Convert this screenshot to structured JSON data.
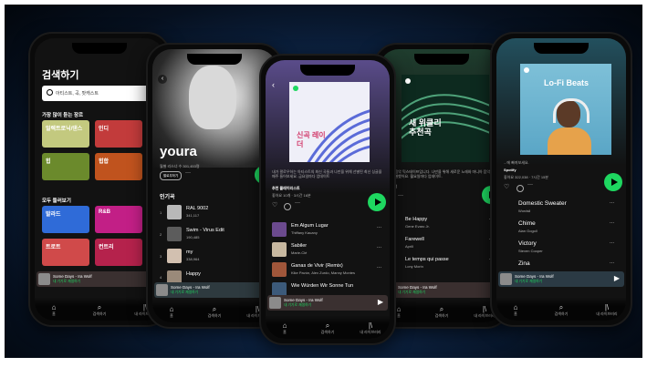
{
  "search_phone": {
    "title": "검색하기",
    "search_placeholder": "아티스트, 곡, 팟캐스트",
    "section_top": "가장 많이 듣는 장르",
    "section_all": "모두 둘러보기",
    "genres": [
      "일렉트로닉/댄스",
      "인디",
      "힙",
      "힙합",
      "발라드",
      "R&B",
      "트로트",
      "컨트리"
    ],
    "miniplayer_track": "Some Days - Ira Wolf",
    "miniplayer_device": "내 기기로 재생하기",
    "nav": [
      "홈",
      "검색하기",
      "내 라이브러리"
    ]
  },
  "artist_phone": {
    "artist": "youra",
    "listeners": "월별 리스너 수 301,453명",
    "follow": "팔로우하기",
    "popular": "인기곡",
    "tracks": [
      {
        "n": "1",
        "title": "RAL 9002",
        "plays": "341,117"
      },
      {
        "n": "2",
        "title": "Swim - Virus Edit",
        "plays": "190,485"
      },
      {
        "n": "3",
        "title": "my",
        "plays": "338,964"
      },
      {
        "n": "4",
        "title": "Happy",
        "plays": ""
      }
    ],
    "miniplayer_track": "Some Days - Ira Wolf",
    "miniplayer_device": "내 기기로 재생하기",
    "nav": [
      "홈",
      "검색하기",
      "내 라이브러리"
    ]
  },
  "playlist_phone": {
    "cover_title": "신곡 레이더",
    "description": "내가 팔로우하는 아티스트의 최신 곡들과 나만을 위해 선별된 최신 싱글을 매주 들어보세요. 금요일마다 업데이트",
    "owner": "추천 플레이리스트",
    "meta": "좋아요 10개 · 3시간 16분",
    "tracks": [
      {
        "title": "Em Algum Lugar",
        "artist": "Thiffany Kauany"
      },
      {
        "title": "Sabiler",
        "artist": "Marie-Clé"
      },
      {
        "title": "Ganas de Vivir (Remix)",
        "artist": "Kike Pavón, Alex Zurdo, Manny Montes"
      },
      {
        "title": "Wie Würden Wir Sonne Tun",
        "artist": ""
      }
    ],
    "miniplayer_track": "Some Days - Ira Wolf",
    "miniplayer_device": "내 기기로 재생하기",
    "nav": [
      "홈",
      "검색하기",
      "내 라이브러리"
    ]
  },
  "weekly_phone": {
    "cover_title": "새 위클리 추천곡",
    "description": "주간 음악 믹스테이프입니다. 나만을 위해 새로운 노래와 마니아 음악 들을 선별했어요. 월요일마다 업데이트.",
    "owner": "추천곡",
    "tracks": [
      {
        "title": "Be Happy",
        "artist": "Gene Evaro Jr."
      },
      {
        "title": "Farewell",
        "artist": "Aprill"
      },
      {
        "title": "Le temps qui passe",
        "artist": "Lony Morin"
      },
      {
        "title": "",
        "artist": ""
      }
    ],
    "miniplayer_track": "Some Days - Ira Wolf",
    "miniplayer_device": "내 기기로 재생하기",
    "nav": [
      "홈",
      "검색하기",
      "내 라이브러리"
    ]
  },
  "lofi_phone": {
    "cover_title": "Lo-Fi Beats",
    "description": "...에 빠져보세요.",
    "owner": "Spotify",
    "meta": "좋아요 322,038 · 7시간 15분",
    "tracks": [
      {
        "title": "Domestic Sweater",
        "artist": "Wordsll"
      },
      {
        "title": "Chime",
        "artist": "Alan Gogoll"
      },
      {
        "title": "Victory",
        "artist": "Steven Cooper"
      },
      {
        "title": "Zina",
        "artist": ""
      }
    ],
    "miniplayer_track": "Some Days - Ira Wolf",
    "miniplayer_device": "내 기기로 재생하기",
    "nav": [
      "홈",
      "검색하기",
      "내 라이브러리"
    ]
  },
  "colors": {
    "accent": "#1ed760",
    "background": "#121212"
  },
  "icons": [
    "search-icon",
    "home-icon",
    "library-icon",
    "play-icon",
    "back-icon",
    "heart-icon",
    "download-icon",
    "more-icon",
    "spotify-logo-icon"
  ]
}
